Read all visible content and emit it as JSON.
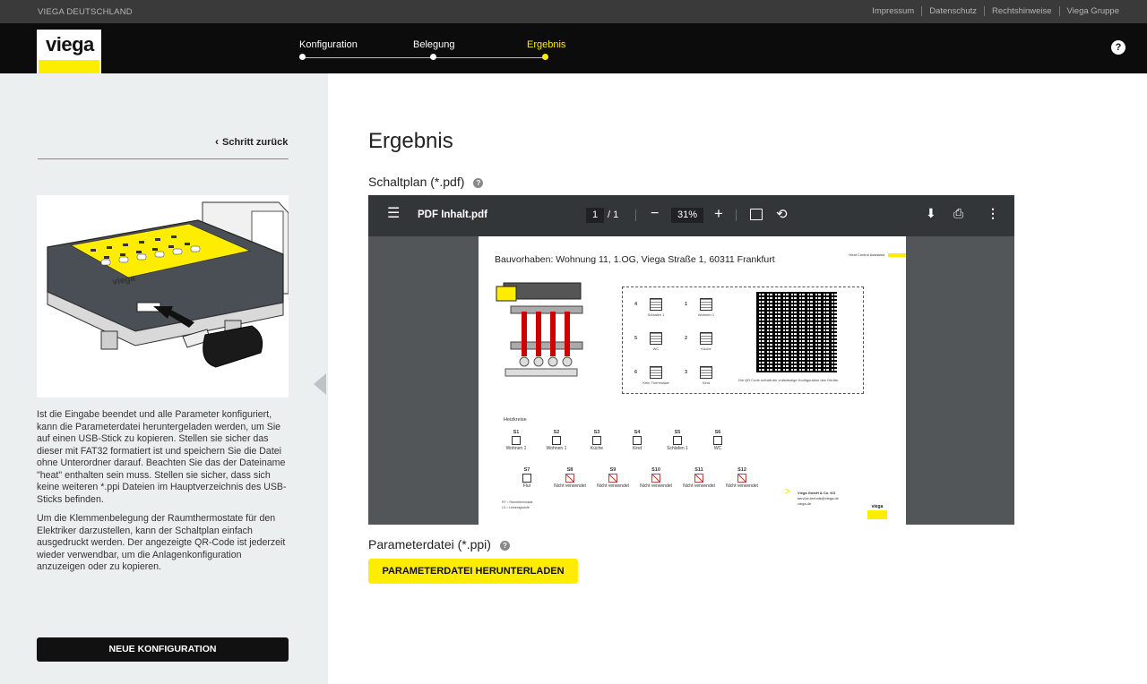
{
  "topbar": {
    "brand": "VIEGA DEUTSCHLAND",
    "links": [
      "Impressum",
      "Datenschutz",
      "Rechtshinweise",
      "Viega Gruppe"
    ]
  },
  "header": {
    "logo_text": "viega",
    "steps": [
      {
        "label": "Konfiguration",
        "state": "done"
      },
      {
        "label": "Belegung",
        "state": "done"
      },
      {
        "label": "Ergebnis",
        "state": "active"
      }
    ],
    "help": "?"
  },
  "sidebar": {
    "back_label": "Schritt zurück",
    "paragraph1": "Ist die Eingabe beendet und alle Parameter konfiguriert, kann die Parameterdatei heruntergeladen werden, um Sie auf einen USB-Stick zu kopieren. Stellen sie sicher das dieser mit FAT32 formatiert ist und speichern Sie die Datei ohne Unterordner darauf. Beachten Sie das der Dateiname \"heat\" enthalten sein muss. Stellen sie sicher, dass sich keine weiteren *.ppi Dateien im Hauptverzeichnis des USB-Sticks befinden.",
    "paragraph2": "Um die Klemmenbelegung der Raumthermostate für den Elektriker darzustellen, kann der Schaltplan einfach ausgedruckt werden. Der angezeigte QR-Code ist jederzeit wieder verwendbar, um die Anlagenkonfiguration anzuzeigen oder zu kopieren.",
    "new_config_label": "NEUE KONFIGURATION"
  },
  "main": {
    "title": "Ergebnis",
    "schaltplan_label": "Schaltplan (*.pdf)",
    "parameter_label": "Parameterdatei (*.ppi)",
    "download_label": "PARAMETERDATEI HERUNTERLADEN"
  },
  "pdf_viewer": {
    "filename": "PDF Inhalt.pdf",
    "page_current": "1",
    "page_total": "/ 1",
    "zoom": "31%",
    "icons": [
      "menu-icon",
      "zoom-out-icon",
      "zoom-in-icon",
      "fit-page-icon",
      "rotate-icon",
      "download-icon",
      "print-icon",
      "more-icon"
    ]
  },
  "pdf_page": {
    "project": "Bauvorhaben: Wohnung 11, 1.OG, Viega Straße 1, 60311 Frankfurt",
    "assistant": "Heat Control Assistant",
    "slots": [
      {
        "num": "4",
        "name": "Schlafen 1"
      },
      {
        "num": "1",
        "name": "Wohnen 1"
      },
      {
        "num": "5",
        "name": "WC"
      },
      {
        "num": "2",
        "name": "Küche"
      },
      {
        "num": "6",
        "name": "Kein Thermostat"
      },
      {
        "num": "3",
        "name": "Kind"
      }
    ],
    "qr_caption": "Die QR Code enthält die vollständige Konfiguration des Geräts.",
    "heizkreise_label": "Heizkreise",
    "circuits_row1": [
      {
        "id": "S1",
        "name": "Wohnen 1"
      },
      {
        "id": "S2",
        "name": "Wohnen 1"
      },
      {
        "id": "S3",
        "name": "Küche"
      },
      {
        "id": "S4",
        "name": "Kind"
      },
      {
        "id": "S5",
        "name": "Schlafen 1"
      },
      {
        "id": "S6",
        "name": "WC"
      }
    ],
    "circuits_row2": [
      {
        "id": "S7",
        "name": "Flur"
      },
      {
        "id": "S8",
        "name": "Nicht verwendet"
      },
      {
        "id": "S9",
        "name": "Nicht verwendet"
      },
      {
        "id": "S10",
        "name": "Nicht verwendet"
      },
      {
        "id": "S11",
        "name": "Nicht verwendet"
      },
      {
        "id": "S12",
        "name": "Nicht verwendet"
      }
    ],
    "legend_rt": "RT = Raumthermostat",
    "legend_ls": "LS = Leistungsstufe",
    "company": "Viega GmbH & Co. KG",
    "company_mail": "service-technik@viega.de",
    "company_web": "viega.de"
  },
  "colors": {
    "accent_yellow": "#ffed00",
    "header_black": "#0c0c0c",
    "sidebar_bg": "#eceff0"
  }
}
